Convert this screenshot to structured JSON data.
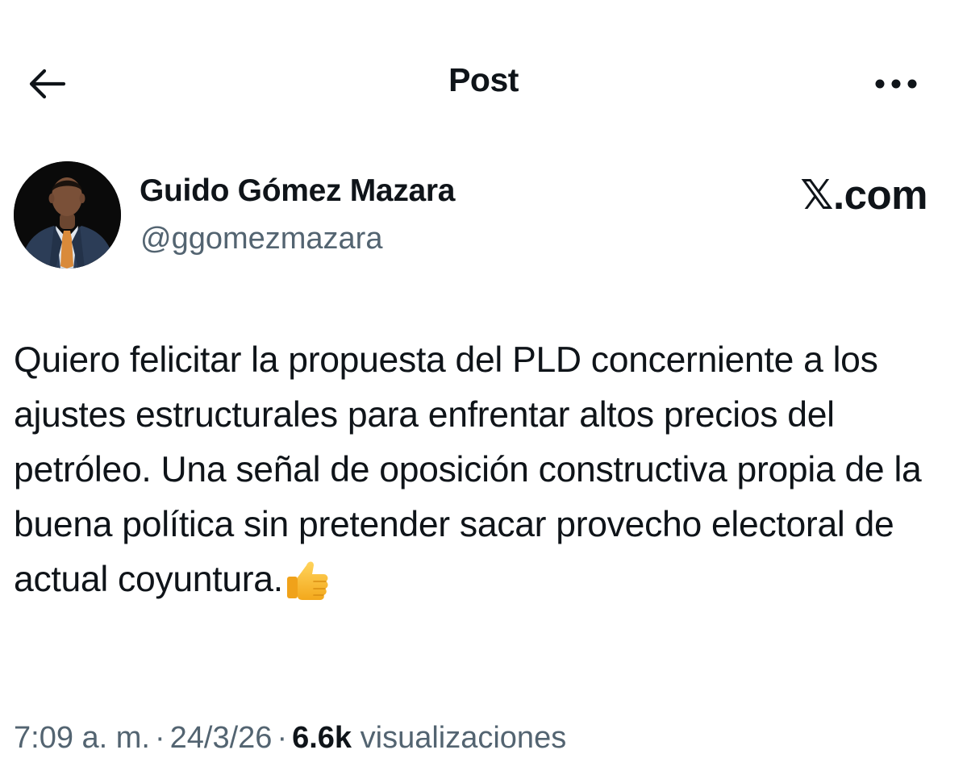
{
  "header": {
    "title": "Post",
    "back_icon": "arrow-left-icon",
    "more_icon": "more-horizontal-icon"
  },
  "author": {
    "name": "Guido Gómez Mazara",
    "handle": "@ggomezmazara"
  },
  "source_badge": "𝕏.com",
  "post": {
    "text": "Quiero felicitar la propuesta del PLD concerniente a los ajustes estructurales para enfrentar altos precios del petróleo. Una señal de oposición constructiva propia de la buena política sin pretender sacar provecho electoral de actual coyuntura.",
    "emoji": "thumbs-up-icon"
  },
  "meta": {
    "time": "7:09 a. m.",
    "separator": "·",
    "date": "24/3/26",
    "views_count": "6.6k",
    "views_label": "visualizaciones"
  },
  "colors": {
    "text_primary": "#0f1419",
    "text_secondary": "#536471",
    "background": "#ffffff"
  }
}
